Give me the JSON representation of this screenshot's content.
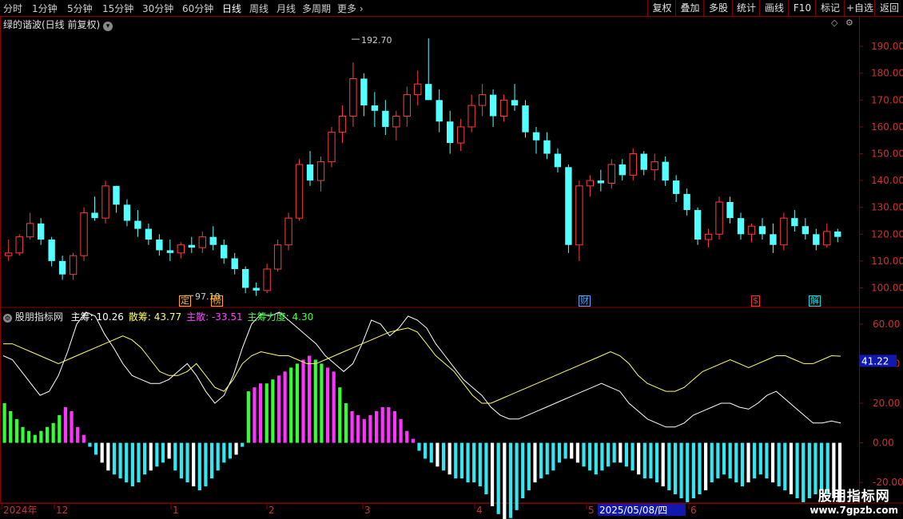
{
  "toolbar": {
    "periods": [
      "分时",
      "1分钟",
      "5分钟",
      "15分钟",
      "30分钟",
      "60分钟",
      "日线",
      "周线",
      "月线",
      "多周期",
      "更多"
    ],
    "active_period": "日线",
    "right_buttons": [
      "复权",
      "叠加",
      "多股",
      "统计",
      "画线",
      "F10",
      "标记",
      "+自选",
      "返回"
    ]
  },
  "main_panel": {
    "title": "绿的谐波(日线 前复权)",
    "price_axis": [
      "190.00",
      "180.00",
      "170.00",
      "160.00",
      "150.00",
      "140.00",
      "130.00",
      "120.00",
      "110.00",
      "100.00"
    ],
    "high_label": "192.70",
    "low_label": "97.10",
    "tags": [
      {
        "text": "定",
        "color": "#ffb000"
      },
      {
        "text": "榜",
        "color": "#ffb000"
      },
      {
        "text": "财",
        "color": "#4da6ff"
      },
      {
        "text": "$",
        "color": "#ff3030"
      },
      {
        "text": "解",
        "color": "#00e0e0"
      }
    ]
  },
  "indicator": {
    "name": "股朋指标网",
    "items": [
      {
        "label": "主筹:",
        "value": "10.26",
        "color": "#ffffff"
      },
      {
        "label": "散筹:",
        "value": "43.77",
        "color": "#ffff66"
      },
      {
        "label": "主散:",
        "value": "-33.51",
        "color": "#ff44ff"
      },
      {
        "label": "主筹力度:",
        "value": "4.30",
        "color": "#44ff44"
      }
    ],
    "axis": [
      "60.00",
      "40.00",
      "20.00",
      "0.00",
      "-20.00"
    ],
    "current_value": "41.22"
  },
  "timeline": {
    "labels": [
      "2024年",
      "12",
      "1",
      "2",
      "3",
      "4",
      "5",
      "6"
    ],
    "cursor_date": "2025/05/08/四"
  },
  "watermark": {
    "title": "股朋指标网",
    "url": "www.7gpzb.com"
  },
  "chart_data": {
    "type": "candlestick",
    "candles": [
      [
        112,
        118,
        110,
        113
      ],
      [
        113,
        120,
        112,
        119
      ],
      [
        119,
        128,
        118,
        124
      ],
      [
        124,
        126,
        116,
        118
      ],
      [
        118,
        119,
        108,
        110
      ],
      [
        110,
        112,
        103,
        105
      ],
      [
        105,
        113,
        103,
        112
      ],
      [
        112,
        130,
        110,
        128
      ],
      [
        128,
        134,
        125,
        126
      ],
      [
        126,
        140,
        124,
        138
      ],
      [
        138,
        138,
        128,
        131
      ],
      [
        131,
        133,
        123,
        125
      ],
      [
        125,
        129,
        119,
        122
      ],
      [
        122,
        124,
        116,
        118
      ],
      [
        118,
        120,
        112,
        114
      ],
      [
        114,
        118,
        110,
        113
      ],
      [
        113,
        117,
        111,
        116
      ],
      [
        116,
        119,
        113,
        115
      ],
      [
        115,
        121,
        113,
        119
      ],
      [
        119,
        123,
        114,
        116
      ],
      [
        116,
        118,
        109,
        111
      ],
      [
        111,
        113,
        105,
        107
      ],
      [
        107,
        108,
        98,
        100
      ],
      [
        100,
        102,
        97,
        99
      ],
      [
        99,
        109,
        98,
        107
      ],
      [
        107,
        118,
        106,
        116
      ],
      [
        116,
        128,
        114,
        126
      ],
      [
        126,
        148,
        125,
        146
      ],
      [
        146,
        151,
        138,
        140
      ],
      [
        140,
        149,
        136,
        147
      ],
      [
        147,
        160,
        145,
        158
      ],
      [
        158,
        168,
        154,
        164
      ],
      [
        164,
        184,
        160,
        178
      ],
      [
        178,
        180,
        164,
        168
      ],
      [
        168,
        173,
        160,
        166
      ],
      [
        166,
        170,
        157,
        160
      ],
      [
        160,
        166,
        155,
        164
      ],
      [
        164,
        175,
        160,
        172
      ],
      [
        172,
        181,
        168,
        176
      ],
      [
        176,
        193,
        172,
        170
      ],
      [
        170,
        174,
        158,
        162
      ],
      [
        162,
        166,
        150,
        154
      ],
      [
        154,
        163,
        151,
        160
      ],
      [
        160,
        172,
        158,
        168
      ],
      [
        168,
        176,
        164,
        172
      ],
      [
        172,
        174,
        160,
        164
      ],
      [
        164,
        172,
        162,
        170
      ],
      [
        170,
        176,
        166,
        168
      ],
      [
        168,
        170,
        156,
        158
      ],
      [
        158,
        160,
        150,
        155
      ],
      [
        155,
        158,
        148,
        150
      ],
      [
        150,
        152,
        143,
        145
      ],
      [
        145,
        146,
        113,
        116
      ],
      [
        116,
        140,
        110,
        138
      ],
      [
        138,
        142,
        134,
        140
      ],
      [
        140,
        144,
        136,
        139
      ],
      [
        139,
        148,
        137,
        146
      ],
      [
        146,
        148,
        140,
        142
      ],
      [
        142,
        152,
        140,
        150
      ],
      [
        150,
        151,
        142,
        144
      ],
      [
        144,
        150,
        140,
        147
      ],
      [
        147,
        149,
        138,
        140
      ],
      [
        140,
        142,
        132,
        135
      ],
      [
        135,
        137,
        127,
        129
      ],
      [
        129,
        130,
        116,
        118
      ],
      [
        118,
        122,
        115,
        120
      ],
      [
        120,
        134,
        118,
        132
      ],
      [
        132,
        134,
        124,
        126
      ],
      [
        126,
        128,
        118,
        120
      ],
      [
        120,
        124,
        117,
        123
      ],
      [
        123,
        126,
        118,
        120
      ],
      [
        120,
        124,
        113,
        116
      ],
      [
        116,
        128,
        114,
        126
      ],
      [
        126,
        129,
        121,
        123
      ],
      [
        123,
        126,
        118,
        120
      ],
      [
        120,
        122,
        114,
        116
      ],
      [
        116,
        124,
        115,
        121
      ],
      [
        121,
        122,
        117,
        119
      ]
    ],
    "indicator_series": [
      {
        "name": "主筹",
        "color": "#ffffff",
        "values": [
          44,
          42,
          36,
          30,
          24,
          26,
          34,
          46,
          60,
          66,
          64,
          55,
          48,
          40,
          34,
          32,
          30,
          30,
          32,
          36,
          40,
          34,
          26,
          20,
          24,
          34,
          48,
          60,
          65,
          64,
          66,
          62,
          58,
          54,
          50,
          44,
          40,
          36,
          40,
          50,
          62,
          60,
          54,
          58,
          64,
          62,
          58,
          50,
          44,
          38,
          32,
          28,
          24,
          18,
          14,
          12,
          12,
          14,
          16,
          18,
          20,
          22,
          24,
          26,
          28,
          30,
          28,
          26,
          20,
          16,
          12,
          10,
          8,
          8,
          10,
          14,
          16,
          18,
          20,
          20,
          18,
          17,
          20,
          24,
          26,
          22,
          18,
          14,
          10,
          10,
          11,
          10
        ]
      },
      {
        "name": "散筹",
        "color": "#ffff66",
        "values": [
          50,
          50,
          48,
          46,
          44,
          42,
          40,
          42,
          44,
          46,
          48,
          50,
          52,
          54,
          52,
          48,
          42,
          36,
          34,
          34,
          36,
          40,
          34,
          28,
          26,
          32,
          40,
          44,
          46,
          45,
          44,
          44,
          42,
          40,
          40,
          42,
          44,
          46,
          48,
          50,
          52,
          54,
          56,
          57,
          58,
          56,
          50,
          44,
          40,
          36,
          30,
          24,
          20,
          20,
          22,
          24,
          26,
          28,
          30,
          32,
          34,
          36,
          38,
          40,
          42,
          44,
          46,
          44,
          40,
          34,
          30,
          28,
          26,
          26,
          28,
          32,
          36,
          38,
          40,
          42,
          40,
          38,
          40,
          42,
          44,
          44,
          42,
          40,
          40,
          42,
          44,
          43.77
        ]
      },
      {
        "name": "主筹力度",
        "type": "bar",
        "values": [
          20,
          16,
          12,
          8,
          6,
          4,
          6,
          8,
          10,
          14,
          18,
          16,
          8,
          4,
          -2,
          -6,
          -10,
          -14,
          -16,
          -18,
          -20,
          -22,
          -20,
          -16,
          -14,
          -12,
          -10,
          -8,
          -14,
          -18,
          -20,
          -22,
          -24,
          -22,
          -18,
          -14,
          -10,
          -8,
          -6,
          -2,
          26,
          28,
          30,
          30,
          32,
          34,
          36,
          38,
          40,
          42,
          44,
          42,
          40,
          38,
          36,
          28,
          20,
          16,
          14,
          12,
          14,
          16,
          18,
          18,
          16,
          12,
          6,
          2,
          -4,
          -8,
          -10,
          -12,
          -14,
          -16,
          -18,
          -18,
          -20,
          -20,
          -22,
          -26,
          -32,
          -36,
          -40,
          -38,
          -34,
          -28,
          -24,
          -20,
          -18,
          -16,
          -14,
          -10,
          -8,
          -8,
          -10,
          -12,
          -14,
          -16,
          -14,
          -12,
          -10,
          -10,
          -12,
          -14,
          -16,
          -18,
          -18,
          -20,
          -22,
          -24,
          -26,
          -28,
          -30,
          -28,
          -26,
          -24,
          -20,
          -18,
          -16,
          -18,
          -20,
          -22,
          -20,
          -18,
          -16,
          -18,
          -20,
          -22,
          -24,
          -26,
          -28,
          -30,
          -28,
          -26,
          -24,
          -26,
          -28,
          -30
        ]
      }
    ]
  }
}
